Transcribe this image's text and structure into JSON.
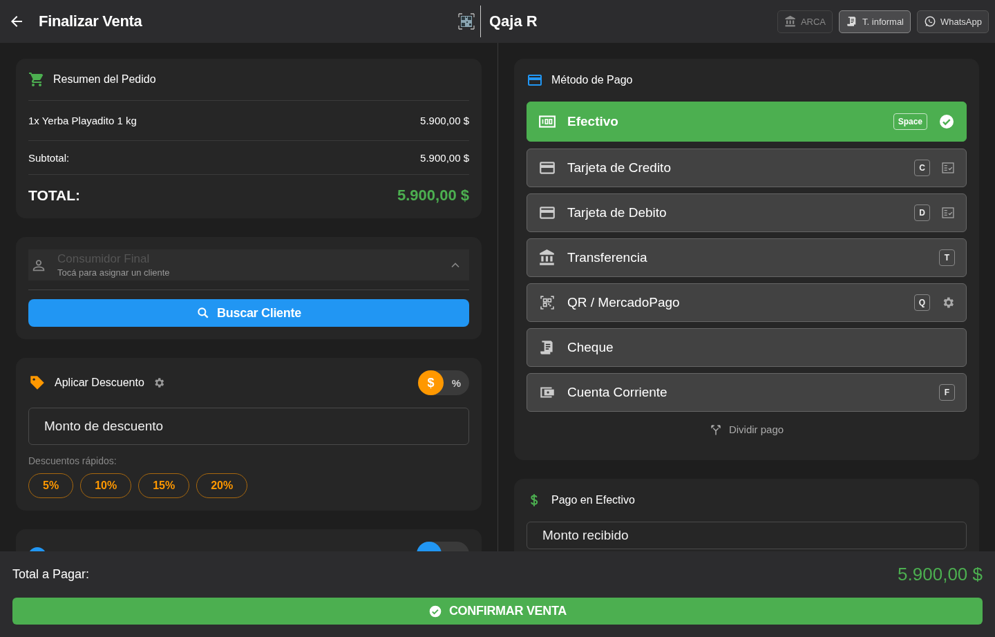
{
  "header": {
    "title": "Finalizar Venta",
    "brand": "Qaja R",
    "actions": [
      {
        "label": "ARCA",
        "disabled": true,
        "active": false
      },
      {
        "label": "T. informal",
        "disabled": false,
        "active": true
      },
      {
        "label": "WhatsApp",
        "disabled": false,
        "active": false
      }
    ]
  },
  "order": {
    "title": "Resumen del Pedido",
    "items": [
      {
        "description": "1x Yerba Playadito 1 kg",
        "amount": "5.900,00 $"
      }
    ],
    "subtotal": {
      "label": "Subtotal:",
      "value": "5.900,00 $"
    },
    "total": {
      "label": "TOTAL:",
      "value": "5.900,00 $"
    }
  },
  "client": {
    "name": "Consumidor Final",
    "hint": "Tocá para asignar un cliente",
    "expanded": true,
    "button": "Buscar Cliente"
  },
  "discount": {
    "title": "Aplicar Descuento",
    "modes": [
      {
        "label": "$",
        "selected": true
      },
      {
        "label": "%",
        "selected": false
      }
    ],
    "field": {
      "placeholder": "Monto de descuento"
    },
    "quick_label": "Descuentos rápidos:",
    "quick": [
      "5%",
      "10%",
      "15%",
      "20%"
    ]
  },
  "payment": {
    "title": "Método de Pago",
    "methods": [
      {
        "label": "Efectivo",
        "shortcut": "Space",
        "selected": true
      },
      {
        "label": "Tarjeta de Credito",
        "shortcut": "C",
        "selected": false
      },
      {
        "label": "Tarjeta de Debito",
        "shortcut": "D",
        "selected": false
      },
      {
        "label": "Transferencia",
        "shortcut": "T",
        "selected": false
      },
      {
        "label": "QR / MercadoPago",
        "shortcut": "Q",
        "selected": false
      },
      {
        "label": "Cheque",
        "selected": false
      },
      {
        "label": "Cuenta Corriente",
        "shortcut": "F",
        "selected": false
      }
    ],
    "split": "Dividir pago"
  },
  "cash_payment": {
    "title": "Pago en Efectivo",
    "field": {
      "placeholder": "Monto recibido"
    }
  },
  "footer": {
    "label": "Total a Pagar:",
    "amount": "5.900,00 $",
    "confirm": "CONFIRMAR VENTA"
  }
}
